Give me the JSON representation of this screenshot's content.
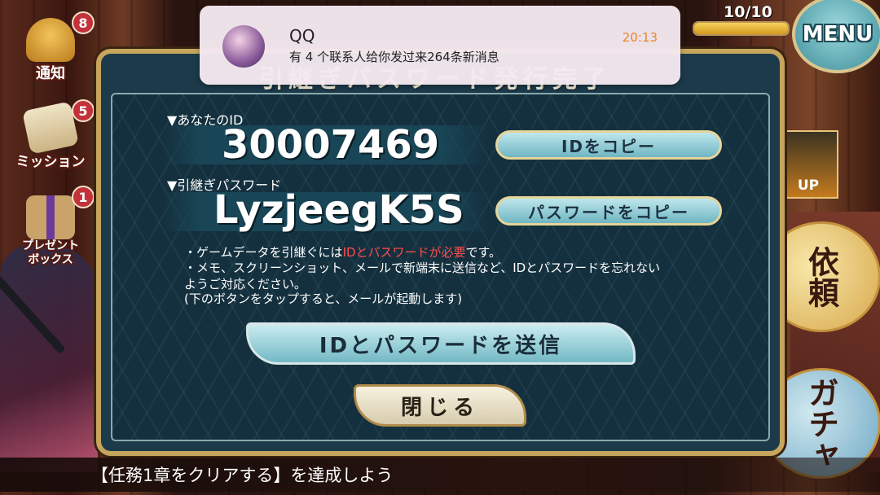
{
  "notification": {
    "app": "QQ",
    "message": "有 4 个联系人给你发过来264条新消息",
    "time": "20:13"
  },
  "hud": {
    "stamina": "10/10",
    "stamina_fraction": 1.0,
    "menu_label": "MENU"
  },
  "side_menu": [
    {
      "label": "通知",
      "badge": "8"
    },
    {
      "label": "ミッション",
      "badge": "5"
    },
    {
      "label": "プレゼントボックス",
      "badge": "1"
    }
  ],
  "right_menu": {
    "banner_label": "UP",
    "request_label": "依頼",
    "gacha_label": "ガチャ"
  },
  "dialog": {
    "title": "引継ぎパスワード発行完了",
    "id_label": "▼あなたのID",
    "id_value": "30007469",
    "copy_id_label": "IDをコピー",
    "password_label": "▼引継ぎパスワード",
    "password_value": "LyzjeegK5S",
    "copy_password_label": "パスワードをコピー",
    "notes": {
      "line1_prefix": "・ゲームデータを引継ぐには",
      "line1_highlight": "IDとパスワードが必要",
      "line1_suffix": "です。",
      "line2": "・メモ、スクリーンショット、メールで新端末に送信など、IDとパスワードを忘れない",
      "line3": "ようご対応ください。",
      "line4": "(下のボタンをタップすると、メールが起動します)"
    },
    "send_label": "IDとパスワードを送信",
    "close_label": "閉じる"
  },
  "mission_bar": {
    "text": "【任務1章をクリアする】を達成しよう"
  },
  "colors": {
    "dialog_bg": "#14303e",
    "frame_gold": "#c7a55c",
    "highlight_red": "#ff4b4b",
    "notif_time": "#e8842a"
  }
}
